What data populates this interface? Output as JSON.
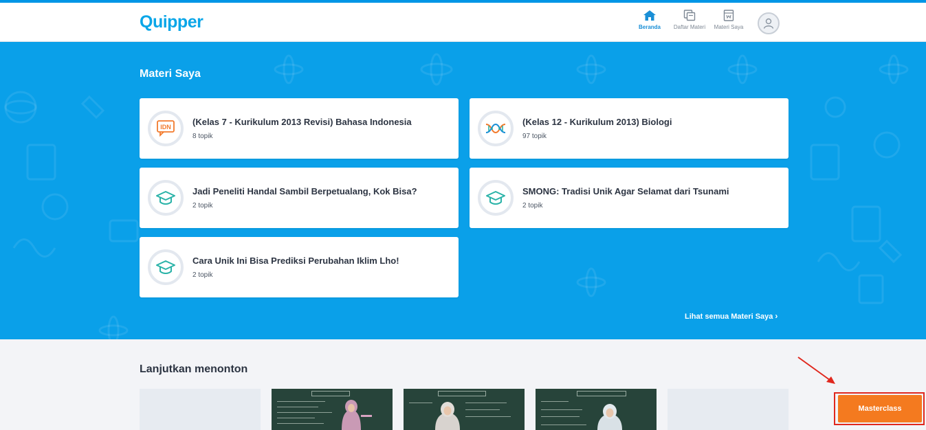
{
  "header": {
    "logo": "Quipper",
    "nav": [
      {
        "label": "Beranda",
        "icon": "home-icon",
        "active": true
      },
      {
        "label": "Daftar Materi",
        "icon": "materials-list-icon",
        "active": false
      },
      {
        "label": "Materi Saya",
        "icon": "my-materials-icon",
        "active": false
      }
    ],
    "avatar_icon": "user-icon"
  },
  "hero": {
    "title": "Materi Saya",
    "cards": [
      {
        "title": "(Kelas 7 - Kurikulum 2013 Revisi) Bahasa Indonesia",
        "count": "8 topik",
        "icon": "idn-badge-icon"
      },
      {
        "title": "(Kelas 12 - Kurikulum 2013) Biologi",
        "count": "97 topik",
        "icon": "dna-icon"
      },
      {
        "title": "Jadi Peneliti Handal Sambil Berpetualang, Kok Bisa?",
        "count": "2 topik",
        "icon": "graduation-cap-icon"
      },
      {
        "title": "SMONG: Tradisi Unik Agar Selamat dari Tsunami",
        "count": "2 topik",
        "icon": "graduation-cap-icon"
      },
      {
        "title": "Cara Unik Ini Bisa Prediksi Perubahan Iklim Lho!",
        "count": "2 topik",
        "icon": "graduation-cap-icon"
      }
    ],
    "see_all": "Lihat semua Materi Saya",
    "see_all_chevron": "›"
  },
  "continue": {
    "title": "Lanjutkan menonton"
  },
  "masterclass": {
    "label": "Masterclass"
  },
  "colors": {
    "brand": "#0aa6e8",
    "hero_bg": "#0aa0e9",
    "accent_orange": "#f47a1f",
    "annotation_red": "#e0271d",
    "idn_orange": "#f27a2c",
    "cap_teal": "#2ab3a8"
  }
}
